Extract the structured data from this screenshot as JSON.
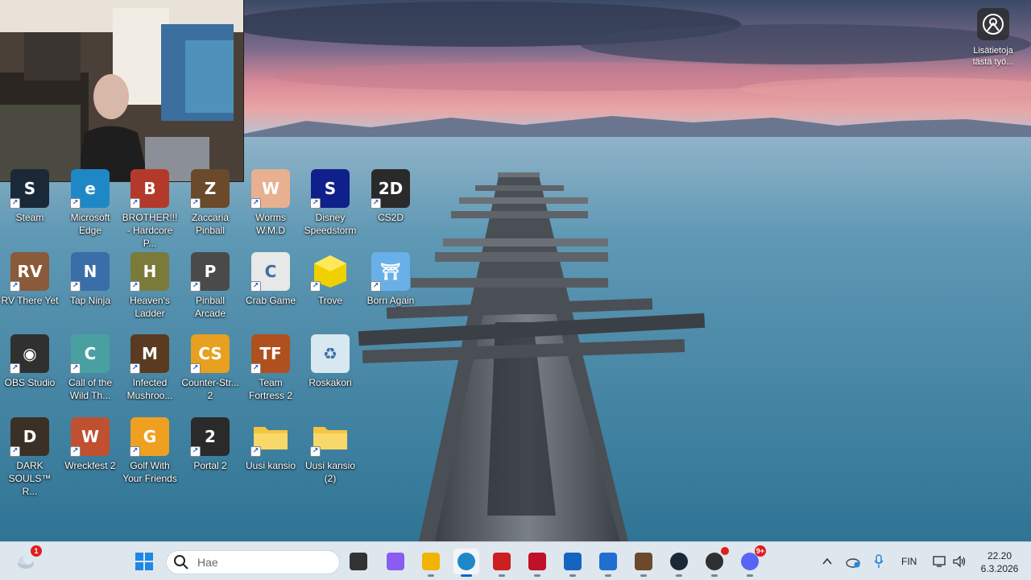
{
  "desktop": {
    "info_widget": {
      "label": "Lisätietoja tästä työ..."
    },
    "icons": [
      {
        "label": "Steam",
        "icon": "steam-icon",
        "color": "#1b2838",
        "glyph": "S"
      },
      {
        "label": "Microsoft Edge",
        "icon": "edge-icon",
        "color": "#1e88c7",
        "glyph": "e"
      },
      {
        "label": "BROTHER!!! - Hardcore P...",
        "icon": "brother-game-icon",
        "color": "#b33a2a",
        "glyph": "B"
      },
      {
        "label": "Zaccaria Pinball",
        "icon": "zaccaria-pinball-icon",
        "color": "#6a4a2a",
        "glyph": "Z"
      },
      {
        "label": "Worms W.M.D",
        "icon": "worms-icon",
        "color": "#e8b090",
        "glyph": "W"
      },
      {
        "label": "Disney Speedstorm",
        "icon": "speedstorm-icon",
        "color": "#10208a",
        "glyph": "S"
      },
      {
        "label": "CS2D",
        "icon": "cs2d-icon",
        "color": "#2a2a2a",
        "glyph": "2D"
      },
      {
        "label": "RV There Yet",
        "icon": "rv-there-yet-icon",
        "color": "#8a5a3a",
        "glyph": "RV"
      },
      {
        "label": "Tap Ninja",
        "icon": "tap-ninja-icon",
        "color": "#3a6ea8",
        "glyph": "N"
      },
      {
        "label": "Heaven's Ladder",
        "icon": "heavens-ladder-icon",
        "color": "#7a7a3a",
        "glyph": "H"
      },
      {
        "label": "Pinball Arcade",
        "icon": "pinball-arcade-icon",
        "color": "#4a4a4a",
        "glyph": "P"
      },
      {
        "label": "Crab Game",
        "icon": "crab-game-icon",
        "color": "#e8e8e8",
        "glyph": "C"
      },
      {
        "label": "Trove",
        "icon": "trove-icon",
        "color": "#f0d000",
        "glyph": ""
      },
      {
        "label": "Born Again",
        "icon": "born-again-icon",
        "color": "#6ab0e8",
        "glyph": "⛩"
      },
      {
        "label": "OBS Studio",
        "icon": "obs-icon",
        "color": "#303030",
        "glyph": "◉"
      },
      {
        "label": "Call of the Wild Th...",
        "icon": "call-of-the-wild-icon",
        "color": "#4aa0a0",
        "glyph": "C"
      },
      {
        "label": "Infected Mushroo...",
        "icon": "infected-mushroom-icon",
        "color": "#5a3a20",
        "glyph": "M"
      },
      {
        "label": "Counter-Str... 2",
        "icon": "counter-strike-icon",
        "color": "#e8a020",
        "glyph": "CS"
      },
      {
        "label": "Team Fortress 2",
        "icon": "tf2-icon",
        "color": "#b0501e",
        "glyph": "TF"
      },
      {
        "label": "Roskakori",
        "icon": "recycle-bin-icon",
        "color": "#d8e8f0",
        "glyph": "♻"
      },
      {
        "label": "DARK SOULS™ R...",
        "icon": "dark-souls-icon",
        "color": "#3a3026",
        "glyph": "D"
      },
      {
        "label": "Wreckfest 2",
        "icon": "wreckfest-icon",
        "color": "#c05030",
        "glyph": "W"
      },
      {
        "label": "Golf With Your Friends",
        "icon": "golf-with-friends-icon",
        "color": "#f0a020",
        "glyph": "G"
      },
      {
        "label": "Portal 2",
        "icon": "portal2-icon",
        "color": "#2a2a2a",
        "glyph": "2"
      },
      {
        "label": "Uusi kansio",
        "icon": "folder-icon",
        "color": "#f5c542",
        "glyph": ""
      },
      {
        "label": "Uusi kansio (2)",
        "icon": "folder-icon",
        "color": "#f5c542",
        "glyph": ""
      }
    ]
  },
  "taskbar": {
    "search": {
      "placeholder": "Hae"
    },
    "weather_badge": "1",
    "apps": [
      {
        "name": "file-explorer-dark",
        "color": "#333333",
        "active": false
      },
      {
        "name": "copilot",
        "color": "#8a5cf0",
        "active": false
      },
      {
        "name": "file-explorer",
        "color": "#f0b400",
        "active": false
      },
      {
        "name": "microsoft-edge",
        "color": "#1e88c7",
        "active": true
      },
      {
        "name": "lastpass",
        "color": "#cc1f1f",
        "active": false
      },
      {
        "name": "mcafee",
        "color": "#c0102a",
        "active": false
      },
      {
        "name": "outlook",
        "color": "#1565c0",
        "active": false
      },
      {
        "name": "microsoft-store",
        "color": "#1e6fd0",
        "active": false
      },
      {
        "name": "game-character",
        "color": "#6a4a2a",
        "active": false
      },
      {
        "name": "steam",
        "color": "#1b2838",
        "active": false
      },
      {
        "name": "obs-studio",
        "color": "#303030",
        "active": false
      },
      {
        "name": "discord",
        "color": "#5865f2",
        "active": false
      }
    ],
    "discord_badge": "9+",
    "tray": {
      "language": "FIN",
      "time": "22.20",
      "date": "6.3.2026"
    }
  },
  "colors": {
    "taskbar_bg": "#dfe7ee",
    "accent": "#1565c0",
    "badge_red": "#e01e1e"
  }
}
